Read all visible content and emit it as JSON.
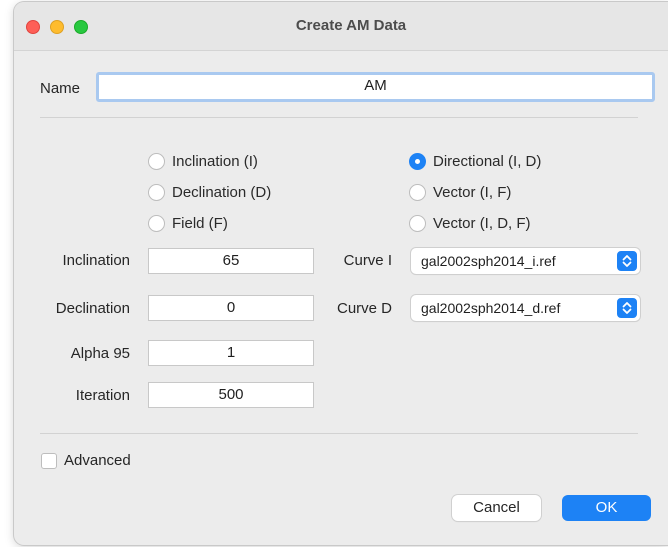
{
  "window": {
    "title": "Create AM Data"
  },
  "name": {
    "label": "Name",
    "value": "AM"
  },
  "left_radios": [
    {
      "label": "Inclination (I)",
      "selected": false
    },
    {
      "label": "Declination (D)",
      "selected": false
    },
    {
      "label": "Field (F)",
      "selected": false
    }
  ],
  "right_radios": [
    {
      "label": "Directional (I, D)",
      "selected": true
    },
    {
      "label": "Vector (I, F)",
      "selected": false
    },
    {
      "label": "Vector (I, D, F)",
      "selected": false
    }
  ],
  "fields": {
    "inclination": {
      "label": "Inclination",
      "value": "65"
    },
    "declination": {
      "label": "Declination",
      "value": "0"
    },
    "alpha95": {
      "label": "Alpha 95",
      "value": "1"
    },
    "iteration": {
      "label": "Iteration",
      "value": "500"
    }
  },
  "curves": {
    "curve_i": {
      "label": "Curve I",
      "value": "gal2002sph2014_i.ref"
    },
    "curve_d": {
      "label": "Curve D",
      "value": "gal2002sph2014_d.ref"
    }
  },
  "advanced": {
    "label": "Advanced",
    "checked": false
  },
  "buttons": {
    "cancel": "Cancel",
    "ok": "OK"
  },
  "colors": {
    "accent": "#1d82f5",
    "close": "#fe5f57",
    "minimize": "#febc2e",
    "maximize": "#28c840"
  },
  "icons": {
    "select_stepper": "chevron-up-down-icon"
  }
}
